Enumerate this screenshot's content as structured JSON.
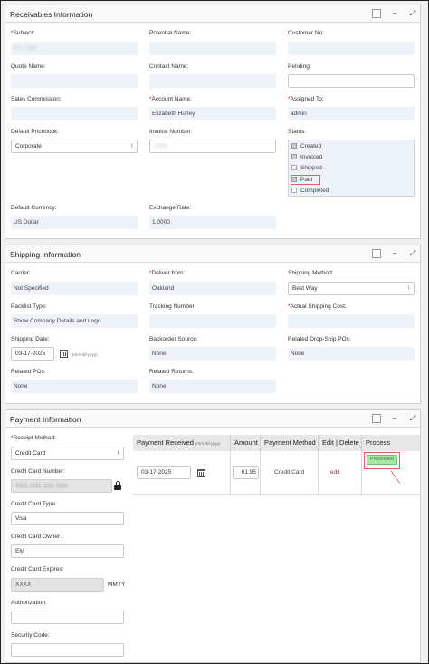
{
  "receivables": {
    "title": "Receivables Information",
    "subject_label": "Subject:",
    "subject_value": "PO-1089",
    "potential_label": "Potential Name:",
    "customer_no_label": "Customer No:",
    "quote_label": "Quote Name:",
    "contact_label": "Contact Name:",
    "pending_label": "Pending:",
    "commission_label": "Sales Commission:",
    "account_label": "Account Name:",
    "account_value": "Elizabeth Hurley",
    "assigned_label": "Assigned To:",
    "assigned_value": "admin",
    "pricebook_label": "Default Pricebook:",
    "pricebook_value": "Corporate",
    "invoice_label": "Invoice Number:",
    "invoice_value": "1053",
    "status_label": "Status:",
    "status_options": [
      "Created",
      "Invoiced",
      "Shipped",
      "Paid",
      "Completed"
    ],
    "currency_label": "Default Currency:",
    "currency_value": "US Dollar",
    "exchange_label": "Exchange Rate:",
    "exchange_value": "1.0000"
  },
  "shipping": {
    "title": "Shipping Information",
    "carrier_label": "Carrier:",
    "carrier_value": "Not Specified",
    "deliver_label": "Deliver from:",
    "deliver_value": "Oakland",
    "method_label": "Shipping Method:",
    "method_value": "Best Way",
    "packlist_label": "Packlist Type:",
    "packlist_value": "Show Company Details and Logo",
    "tracking_label": "Tracking Number:",
    "actual_cost_label": "Actual Shipping Cost:",
    "ship_date_label": "Shipping Date:",
    "ship_date_value": "03-17-2025",
    "date_hint": "(mm-dd-yyyy)",
    "backorder_label": "Backorder Source:",
    "backorder_value": "None",
    "dropship_label": "Related Drop-Ship POs:",
    "dropship_value": "None",
    "related_pos_label": "Related POs:",
    "related_pos_value": "None",
    "returns_label": "Related Returns:",
    "returns_value": "None"
  },
  "payment": {
    "title": "Payment Information",
    "receipt_label": "Receipt Method:",
    "receipt_value": "Credit Card",
    "cc_number_label": "Credit Card Number:",
    "cc_number_value": "4111 1111 1111 1111",
    "cc_type_label": "Credit Card Type:",
    "cc_type_value": "Visa",
    "cc_owner_label": "Credit Card Owner:",
    "cc_owner_value": "Ely",
    "cc_expires_label": "Credit Card Expires:",
    "cc_expires_value": "XXXX",
    "cc_expires_format": "MMYY",
    "authorization_label": "Authorization:",
    "security_label": "Security Code:",
    "table": {
      "col_received": "Payment Received",
      "col_received_hint": "(mm-dd-yyyy)",
      "col_amount": "Amount",
      "col_method": "Payment Method",
      "col_edit": "Edit | Delete",
      "col_process": "Process",
      "row_date": "03-17-2025",
      "row_amount": "61.95",
      "row_method": "Credit Card",
      "row_edit": "edit",
      "row_process": "Processed"
    }
  },
  "required_mark": "*",
  "panel_controls": {
    "restore": "□",
    "minimize": "–",
    "maximize": "⤢"
  }
}
